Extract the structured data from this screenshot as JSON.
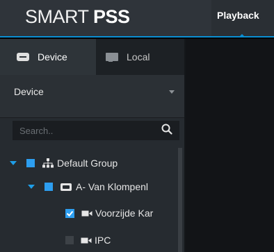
{
  "app": {
    "brand_part1": "SMART ",
    "brand_part2": "PSS",
    "active_tab": "Playback"
  },
  "panel": {
    "tabs": [
      {
        "label": "Device",
        "icon": "hdd-icon",
        "active": true
      },
      {
        "label": "Local",
        "icon": "monitor-icon",
        "active": false
      }
    ],
    "selector": {
      "value": "Device"
    },
    "search": {
      "placeholder": "Search..",
      "value": ""
    }
  },
  "tree": {
    "nodes": [
      {
        "label": "Default Group",
        "icon": "org-tree-icon",
        "check": "partial",
        "expanded": true
      },
      {
        "label": "A- Van Klompenl",
        "icon": "nvr-icon",
        "check": "partial",
        "expanded": true
      },
      {
        "label": "Voorzijde Kar",
        "icon": "camera-icon",
        "check": "checked"
      },
      {
        "label": "IPC",
        "icon": "camera-icon",
        "check": "unchecked"
      }
    ]
  },
  "colors": {
    "accent": "#0a8fd3",
    "checkbox": "#2d9ef0",
    "panel_bg": "#262b30",
    "header_bg": "#2f343a"
  }
}
